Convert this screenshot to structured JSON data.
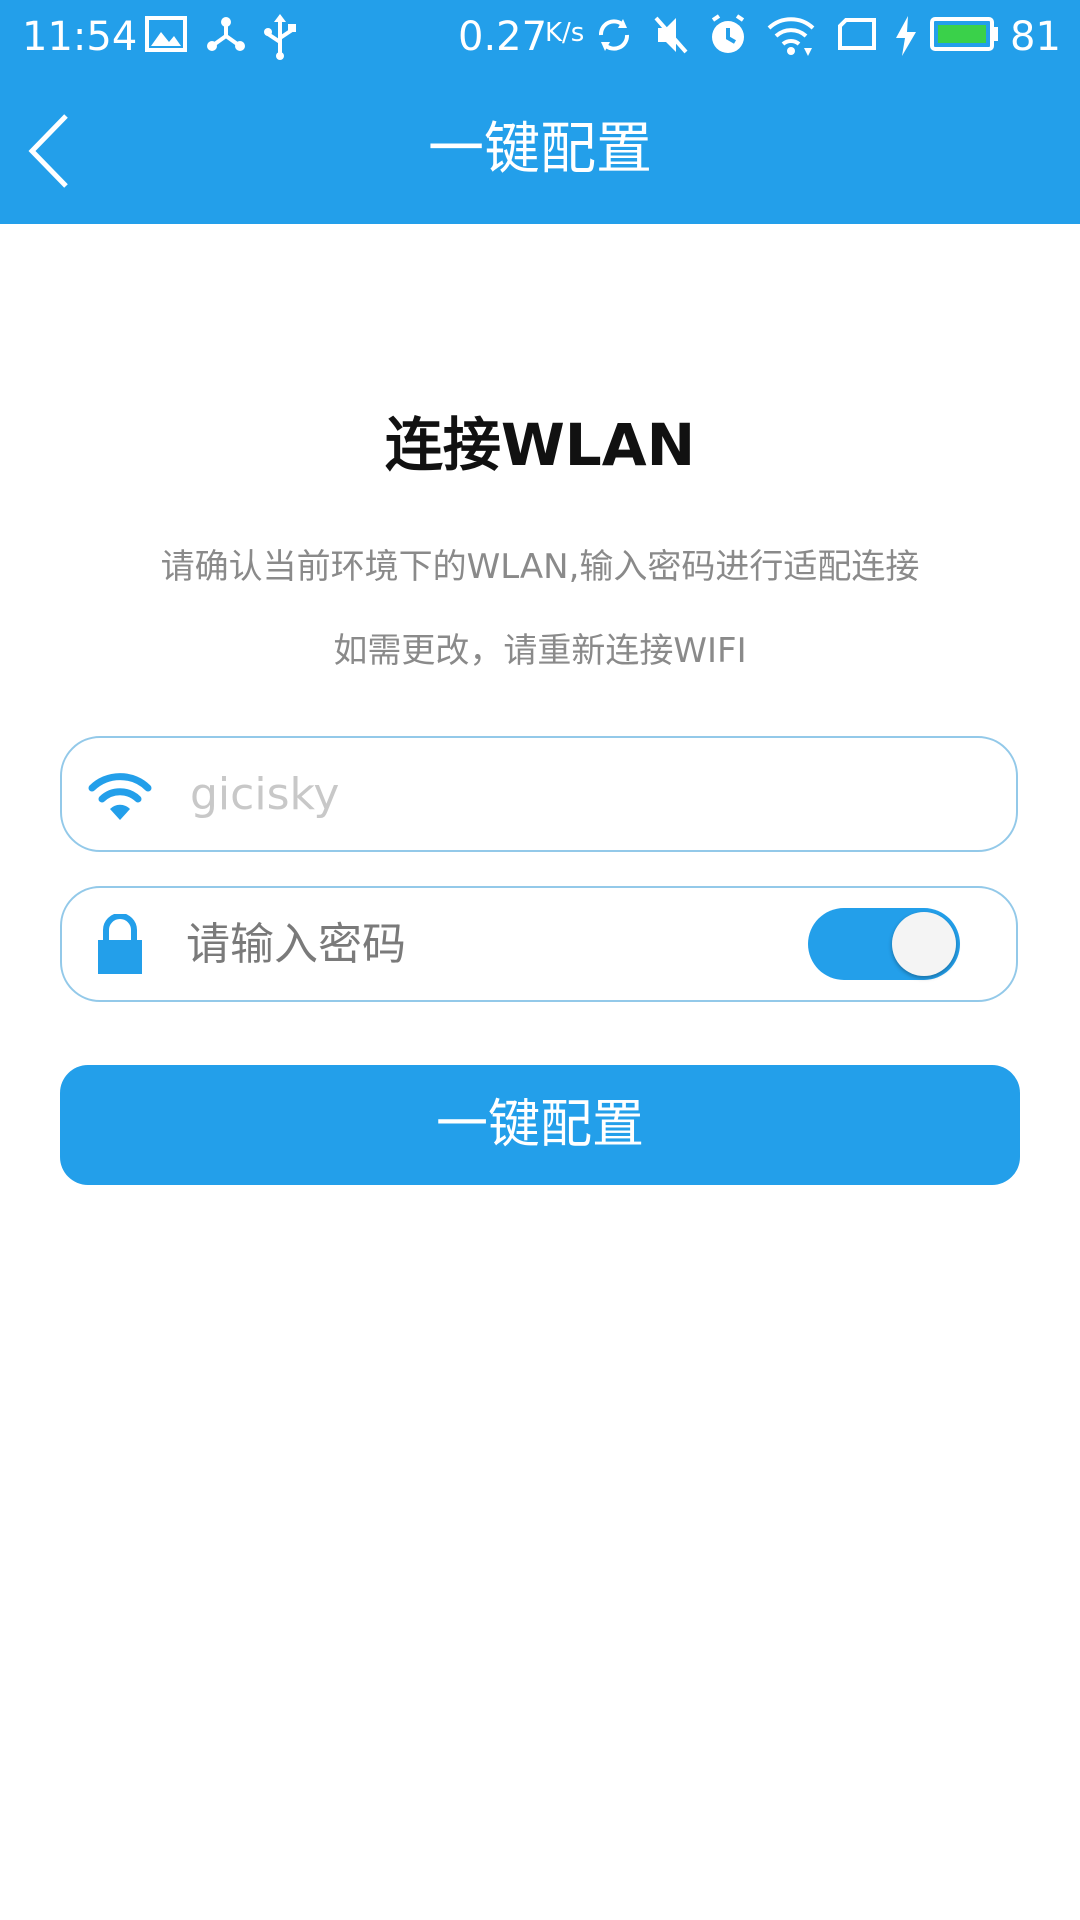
{
  "status_bar": {
    "time": "11:54",
    "net_speed": "0.27",
    "net_speed_unit": "K/s",
    "battery_level": "81",
    "icons": [
      "image-icon",
      "share-icon",
      "usb-icon",
      "sync-icon",
      "mute-icon",
      "alarm-icon",
      "wifi-icon",
      "sim-icon",
      "charging-icon",
      "battery-icon"
    ],
    "battery_color": "#3ad14a"
  },
  "app_bar": {
    "title": "一键配置",
    "back_icon": "chevron-left-icon"
  },
  "main": {
    "heading": "连接WLAN",
    "description_line1": "请确认当前环境下的WLAN,输入密码进行适配连接",
    "description_line2": "如需更改，请重新连接WIFI",
    "ssid_field": {
      "icon": "wifi-icon",
      "value": "gicisky"
    },
    "password_field": {
      "icon": "lock-icon",
      "placeholder": "请输入密码",
      "show_password_toggle": true
    },
    "submit_label": "一键配置"
  },
  "colors": {
    "accent": "#239fea",
    "field_border": "#93c9e9"
  }
}
